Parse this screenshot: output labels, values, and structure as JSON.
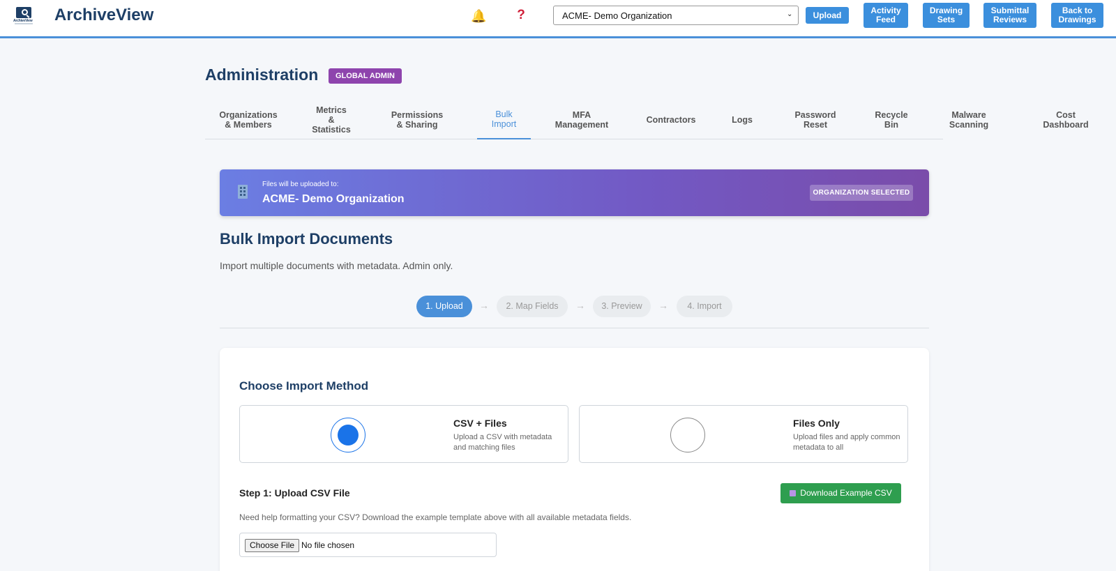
{
  "header": {
    "app_title": "ArchiveView",
    "logo_text": "ArchiveView",
    "bell_icon": "bell-icon",
    "help_icon": "question-icon",
    "org_select_value": "ACME- Demo Organization",
    "upload": "Upload",
    "activity_feed": [
      "Activity",
      "Feed"
    ],
    "drawing_sets": [
      "Drawing",
      "Sets"
    ],
    "submittal_reviews": [
      "Submittal",
      "Reviews"
    ],
    "back_to_drawings": [
      "Back to",
      "Drawings"
    ]
  },
  "admin": {
    "title": "Administration",
    "badge": "GLOBAL ADMIN"
  },
  "tabs": [
    {
      "lines": [
        "Organizations",
        "& Members"
      ]
    },
    {
      "lines": [
        "Metrics",
        "&",
        "Statistics"
      ]
    },
    {
      "lines": [
        "Permissions",
        "& Sharing"
      ]
    },
    {
      "lines": [
        "Bulk",
        "Import"
      ]
    },
    {
      "lines": [
        "MFA",
        "Management"
      ]
    },
    {
      "lines": [
        "Contractors"
      ]
    },
    {
      "lines": [
        "Logs"
      ]
    },
    {
      "lines": [
        "Password",
        "Reset"
      ]
    },
    {
      "lines": [
        "Recycle",
        "Bin"
      ]
    },
    {
      "lines": [
        "Malware",
        "Scanning"
      ]
    },
    {
      "lines": [
        "Cost",
        "Dashboard"
      ]
    }
  ],
  "banner": {
    "icon": "building-icon",
    "small": "Files will be uploaded to:",
    "org": "ACME- Demo Organization",
    "badge": "ORGANIZATION SELECTED"
  },
  "page": {
    "title": "Bulk Import Documents",
    "subtitle": "Import multiple documents with metadata. Admin only."
  },
  "stepper": {
    "steps": [
      "1. Upload",
      "2. Map Fields",
      "3. Preview",
      "4. Import"
    ],
    "arrow": "→"
  },
  "card": {
    "title": "Choose Import Method",
    "methods": [
      {
        "name": "CSV + Files",
        "desc": "Upload a CSV with metadata and matching files",
        "selected": true
      },
      {
        "name": "Files Only",
        "desc": "Upload files and apply common metadata to all",
        "selected": false
      }
    ],
    "step1_title": "Step 1: Upload CSV File",
    "download_btn": "Download Example CSV",
    "download_icon": "csv-icon",
    "help_text": "Need help formatting your CSV? Download the example template above with all available metadata fields.",
    "choose_file": "Choose File",
    "no_file": "No file chosen"
  },
  "colors": {
    "accent": "#4a90d9",
    "brand": "#1e3f66",
    "badge": "#8e44ad",
    "download": "#2e9e4f"
  }
}
